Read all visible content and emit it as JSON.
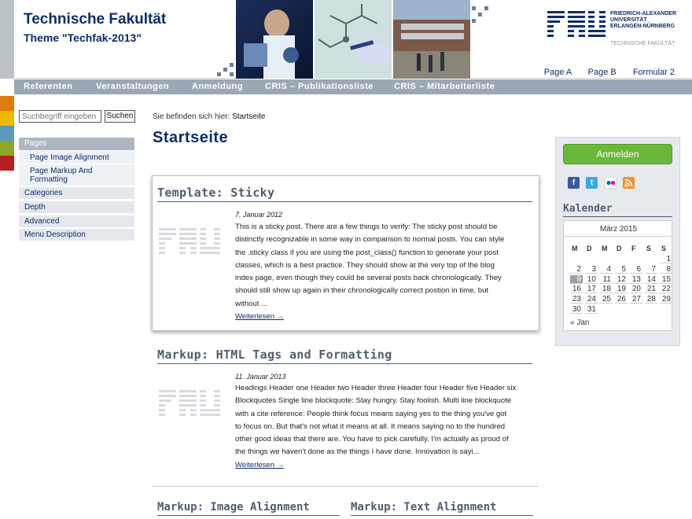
{
  "header": {
    "site_title": "Technische Fakultät",
    "site_subtitle": "Theme \"Techfak-2013\"",
    "logo_name": "FAU",
    "logo_line1": "FRIEDRICH-ALEXANDER",
    "logo_line2": "UNIVERSITÄT",
    "logo_line3": "ERLANGEN-NÜRNBERG",
    "logo_line4": "TECHNISCHE FAKULTÄT",
    "meta_links": [
      "Page A",
      "Page B",
      "Formular 2"
    ]
  },
  "nav": {
    "items": [
      "Referenten",
      "Veranstaltungen",
      "Anmeldung",
      "CRIS – Publikationsliste",
      "CRIS – Mitarbeiterliste"
    ]
  },
  "sidebar": {
    "search_placeholder": "Suchbegriff eingeben",
    "search_button": "Suchen",
    "pages_heading": "Pages",
    "pages_sub": [
      "Page Image Alignment",
      "Page Markup And Formatting"
    ],
    "items": [
      "Categories",
      "Depth",
      "Advanced",
      "Menu Description"
    ]
  },
  "content": {
    "breadcrumb_prefix": "Sie befinden sich hier:",
    "breadcrumb_current": "Startseite",
    "page_title": "Startseite",
    "posts": [
      {
        "title": "Template: Sticky",
        "date": "7. Januar 2012",
        "lines": [
          "This is a sticky post. There are a few things to verify: The sticky post should be",
          "distinctly recognizable in some way in comparison to normal posts. You can style",
          "the .sticky class if you are using the post_class() function to generate your post",
          "classes, which is a best practice. They should show at the very top of the blog",
          "index page, even though they could be several posts back chronologically. They",
          "should still show up again in their chronologically correct postion in time, but",
          "without ..."
        ],
        "more": "Weiterlesen →"
      },
      {
        "title": "Markup: HTML Tags and Formatting",
        "date": "11. Januar 2013",
        "lines": [
          "Headings Header one Header two Header three Header four Header five Header six",
          "Blockquotes Single line blockquote: Stay hungry. Stay foolish. Multi line blockquote",
          "with a cite reference: People think focus means saying yes to the thing you've got",
          "to focus on. But that's not what it means at all. It means saying no to the hundred",
          "other good ideas that there are. You have to pick carefully. I'm actually as proud of",
          "the things we haven't done as the things I have done. Innovation is sayi..."
        ],
        "more": "Weiterlesen →"
      }
    ],
    "bottom_titles": [
      "Markup: Image Alignment",
      "Markup: Text Alignment"
    ]
  },
  "right": {
    "login_button": "Anmelden",
    "social_icons": [
      "facebook-icon",
      "twitter-icon",
      "flickr-icon",
      "rss-icon"
    ],
    "calendar_title": "Kalender",
    "calendar_caption": "März 2015",
    "weekdays": [
      "M",
      "D",
      "M",
      "D",
      "F",
      "S",
      "S"
    ],
    "weeks": [
      [
        "",
        "",
        "",
        "",
        "",
        "",
        "1"
      ],
      [
        "2",
        "3",
        "4",
        "5",
        "6",
        "7",
        "8"
      ],
      [
        "9",
        "10",
        "11",
        "12",
        "13",
        "14",
        "15"
      ],
      [
        "16",
        "17",
        "18",
        "19",
        "20",
        "21",
        "22"
      ],
      [
        "23",
        "24",
        "25",
        "26",
        "27",
        "28",
        "29"
      ],
      [
        "30",
        "31",
        "",
        "",
        "",
        "",
        ""
      ]
    ],
    "today": "9",
    "prev_link": "« Jan"
  },
  "colors": {
    "brand_blue": "#0c2d6b",
    "nav_grey": "#9aa7b5",
    "login_green": "#6ab83a",
    "strip": [
      "#e07b10",
      "#f0b800",
      "#5b9ab8",
      "#8aa82a",
      "#b82020"
    ]
  }
}
